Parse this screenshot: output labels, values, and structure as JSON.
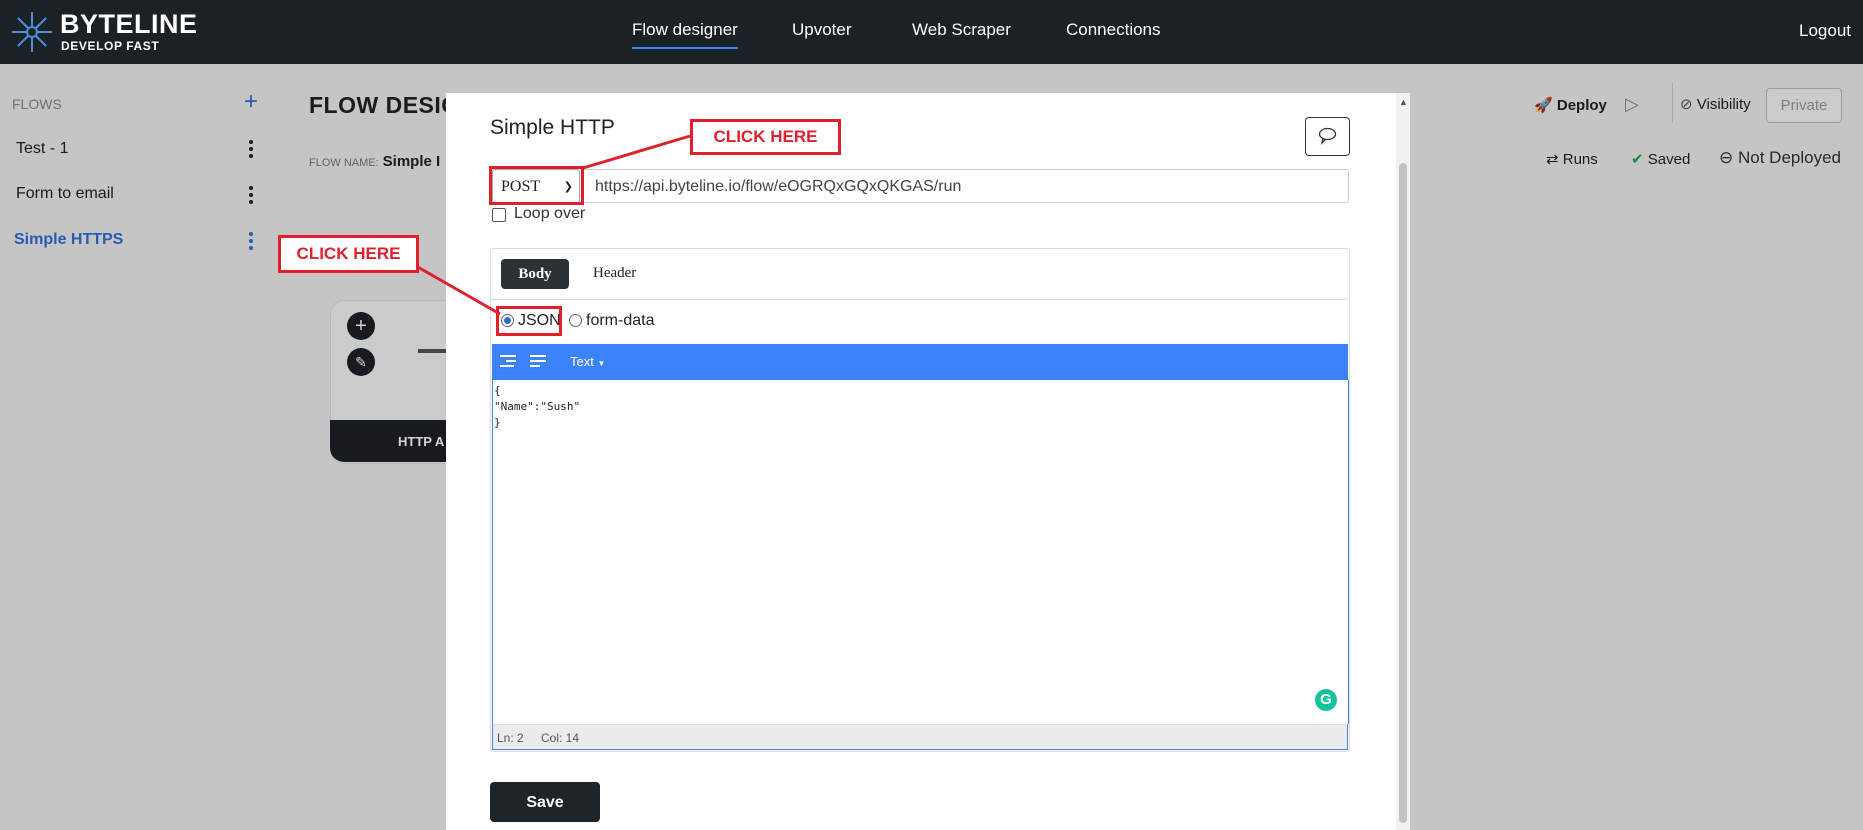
{
  "brand": {
    "name": "BYTELINE",
    "tagline": "DEVELOP FAST"
  },
  "nav": {
    "items": [
      "Flow designer",
      "Upvoter",
      "Web Scraper",
      "Connections"
    ],
    "active": "Flow designer",
    "logout": "Logout"
  },
  "sidebar": {
    "title": "FLOWS",
    "items": [
      {
        "label": "Test - 1"
      },
      {
        "label": "Form to email"
      },
      {
        "label": "Simple HTTPS",
        "active": true
      }
    ]
  },
  "page": {
    "title": "FLOW DESIG",
    "flow_name_label": "FLOW NAME:",
    "flow_name_value": "Simple I"
  },
  "canvas": {
    "node_label": "HTTP A"
  },
  "toolbar": {
    "deploy": "Deploy",
    "visibility": "Visibility",
    "private": "Private",
    "runs": "Runs",
    "saved": "Saved",
    "deploy_status": "Not Deployed"
  },
  "modal": {
    "title": "Simple HTTP",
    "method": "POST",
    "url": "https://api.byteline.io/flow/eOGRQxGQxQKGAS/run",
    "loop_label": "Loop over",
    "tabs": {
      "body": "Body",
      "header": "Header"
    },
    "radios": {
      "json": "JSON",
      "form_data": "form-data"
    },
    "editor_mode": "Text",
    "code_lines": [
      "{",
      "\"Name\":\"Sush\"",
      "}"
    ],
    "status": {
      "ln": "Ln: 2",
      "col": "Col: 14"
    },
    "save_label": "Save"
  },
  "annotations": {
    "callout_1": "CLICK HERE",
    "callout_2": "CLICK HERE"
  },
  "colors": {
    "accent": "#3b82f6",
    "callout": "#e0202a",
    "topbar": "#1c2126",
    "active_link": "#2f6fd6"
  }
}
